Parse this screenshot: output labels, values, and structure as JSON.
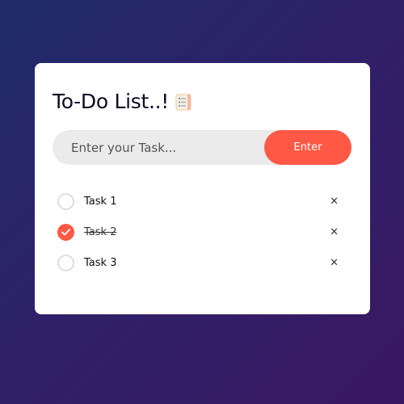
{
  "app": {
    "title": "To-Do List..!",
    "title_icon": "notepad-icon"
  },
  "input": {
    "placeholder": "Enter your Task...",
    "value": ""
  },
  "enter_button": {
    "label": "Enter"
  },
  "tasks": [
    {
      "label": "Task 1",
      "completed": false,
      "delete_label": "×"
    },
    {
      "label": "Task 2",
      "completed": true,
      "delete_label": "×"
    },
    {
      "label": "Task 3",
      "completed": false,
      "delete_label": "×"
    }
  ],
  "colors": {
    "accent": "#ff5945",
    "card": "#ffffff",
    "input_bg": "#ebebeb",
    "background_start": "#1f2b6b",
    "background_end": "#3a1762"
  }
}
